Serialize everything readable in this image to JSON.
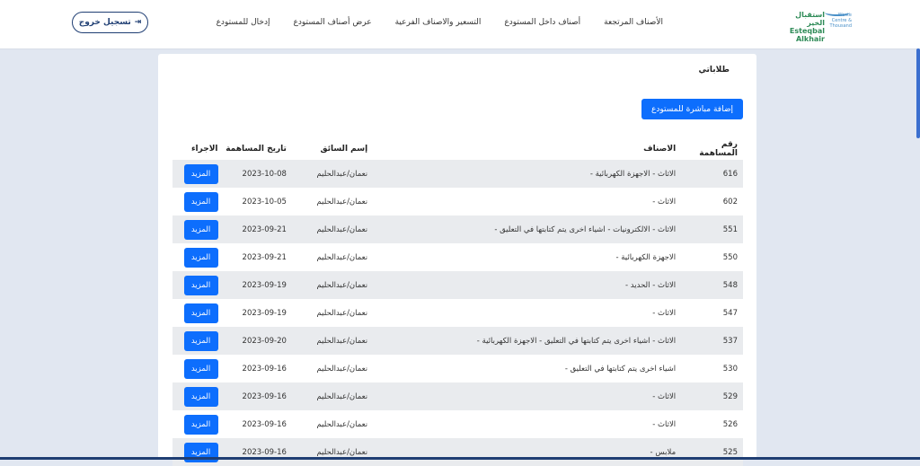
{
  "header": {
    "logo_text": "استقبال الخير Esteqbal Alkhair",
    "logo_subtext": "Waste Centre & Thousand",
    "nav": [
      "إدخال للمستودع",
      "عرض أصناف المستودع",
      "التسعير والاصناف الفرعية",
      "أصناف داخل المستودع",
      "الأصناف المرتجعة"
    ],
    "logout_label": "تسجيل خروج",
    "logout_icon": "sign-out-icon"
  },
  "page": {
    "title": "طلاباتي",
    "add_button": "إضافة مباشرة للمستودع"
  },
  "table": {
    "headers": [
      "رقم المساهمة",
      "الاصناف",
      "إسم السائق",
      "تاريخ المساهمة",
      "الاجراء"
    ],
    "action_label": "المزيد",
    "rows": [
      {
        "id": "616",
        "items": "الاثاث - الاجهزة الكهربائية -",
        "driver": "نعمان/عبدالحليم",
        "date": "2023-10-08"
      },
      {
        "id": "602",
        "items": "الاثاث -",
        "driver": "نعمان/عبدالحليم",
        "date": "2023-10-05"
      },
      {
        "id": "551",
        "items": "الاثاث - الالكترونيات - اشياء اخرى يتم كتابتها في التعليق -",
        "driver": "نعمان/عبدالحليم",
        "date": "2023-09-21"
      },
      {
        "id": "550",
        "items": "الاجهزة الكهربائية -",
        "driver": "نعمان/عبدالحليم",
        "date": "2023-09-21"
      },
      {
        "id": "548",
        "items": "الاثاث - الحديد -",
        "driver": "نعمان/عبدالحليم",
        "date": "2023-09-19"
      },
      {
        "id": "547",
        "items": "الاثاث -",
        "driver": "نعمان/عبدالحليم",
        "date": "2023-09-19"
      },
      {
        "id": "537",
        "items": "الاثاث - اشياء اخرى يتم كتابتها في التعليق - الاجهزة الكهربائية -",
        "driver": "نعمان/عبدالحليم",
        "date": "2023-09-20"
      },
      {
        "id": "530",
        "items": "اشياء اخرى يتم كتابتها في التعليق -",
        "driver": "نعمان/عبدالحليم",
        "date": "2023-09-16"
      },
      {
        "id": "529",
        "items": "الاثاث -",
        "driver": "نعمان/عبدالحليم",
        "date": "2023-09-16"
      },
      {
        "id": "526",
        "items": "الاثاث -",
        "driver": "نعمان/عبدالحليم",
        "date": "2023-09-16"
      },
      {
        "id": "525",
        "items": "ملابس -",
        "driver": "نعمان/عبدالحليم",
        "date": "2023-09-16"
      }
    ]
  },
  "colors": {
    "primary": "#0d6efd",
    "navy": "#1f3e73",
    "page_bg": "#e1e7f1",
    "stripe": "#e9ebee"
  }
}
